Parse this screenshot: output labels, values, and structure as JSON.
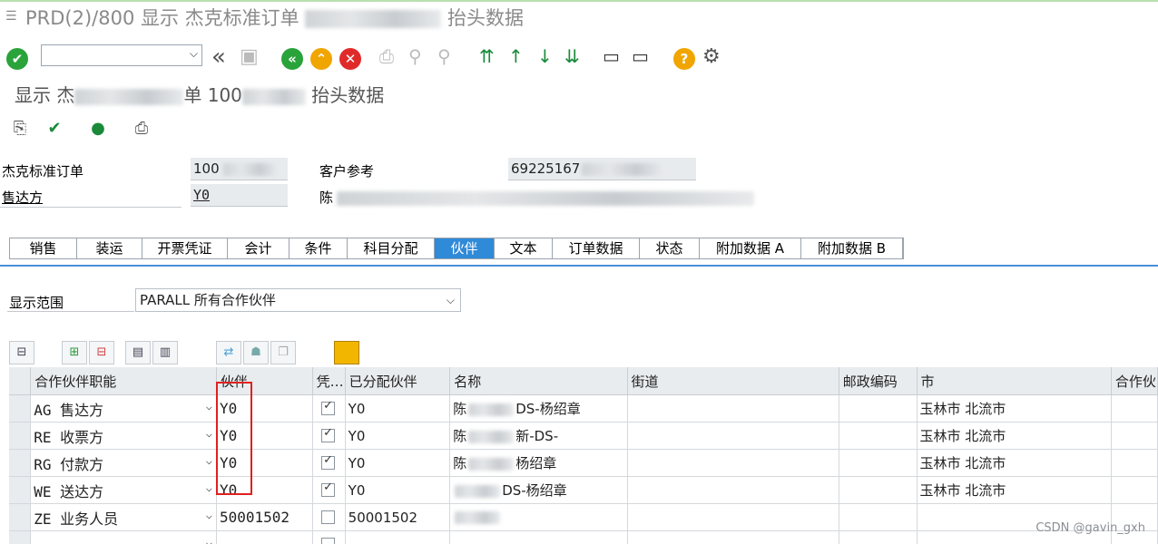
{
  "window": {
    "title_visible": "PRD(2)/800 显示 杰克标准订单 ",
    "title_end": "抬头数据"
  },
  "toolbar": {
    "command_field": "",
    "icons": [
      "enter-icon",
      "back-double-icon",
      "save-icon",
      "back-icon",
      "exit-icon",
      "cancel-icon",
      "print-icon",
      "find-icon",
      "find-next-icon",
      "first-page-icon",
      "prev-page-icon",
      "next-page-icon",
      "last-page-icon",
      "create-session-icon",
      "shortcut-icon",
      "help-icon",
      "settings-icon"
    ]
  },
  "page_title": {
    "prefix": "显示 杰",
    "mid": "单 100",
    "suffix": "抬头数据"
  },
  "header": {
    "order_label": "杰克标准订单",
    "order_value": "100",
    "customer_ref_label": "客户参考",
    "customer_ref_value": "69225167",
    "sold_to_label": "售达方",
    "sold_to_value": "Y0",
    "sold_to_name": "陈"
  },
  "tabs": [
    {
      "label": "销售",
      "width": 74
    },
    {
      "label": "装运",
      "width": 72
    },
    {
      "label": "开票凭证",
      "width": 94
    },
    {
      "label": "会计",
      "width": 68
    },
    {
      "label": "条件",
      "width": 64
    },
    {
      "label": "科目分配",
      "width": 96
    },
    {
      "label": "伙伴",
      "width": 66,
      "active": true
    },
    {
      "label": "文本",
      "width": 64
    },
    {
      "label": "订单数据",
      "width": 96
    },
    {
      "label": "状态",
      "width": 66
    },
    {
      "label": "附加数据 A",
      "width": 112
    },
    {
      "label": "附加数据 B",
      "width": 112
    }
  ],
  "display_range": {
    "label": "显示范围",
    "value": "PARALL 所有合作伙伴"
  },
  "grid": {
    "columns": [
      "合作伙伴职能",
      "伙伴",
      "凭…",
      "已分配伙伴",
      "名称",
      "街道",
      "邮政编码",
      "市",
      "合作伙"
    ],
    "rows": [
      {
        "role": "AG 售达方",
        "partner": "Y0",
        "checked": true,
        "assigned": "Y0",
        "name": "陈",
        "name_tail": "DS-杨绍章",
        "street": "",
        "postal": "",
        "city": "玉林市 北流市"
      },
      {
        "role": "RE 收票方",
        "partner": "Y0",
        "checked": true,
        "assigned": "Y0",
        "name": "陈",
        "name_tail": "新-DS-",
        "street": "",
        "postal": "",
        "city": "玉林市 北流市"
      },
      {
        "role": "RG 付款方",
        "partner": "Y0",
        "checked": true,
        "assigned": "Y0",
        "name": "陈",
        "name_tail": "杨绍章",
        "street": "",
        "postal": "",
        "city": "玉林市 北流市"
      },
      {
        "role": "WE 送达方",
        "partner": "Y0",
        "checked": true,
        "assigned": "Y0",
        "name": "",
        "name_tail": "DS-杨绍章",
        "street": "",
        "postal": "",
        "city": "玉林市 北流市"
      },
      {
        "role": "ZE 业务人员",
        "partner": "50001502",
        "checked": false,
        "assigned": "50001502",
        "name": "",
        "name_tail": "",
        "street": "",
        "postal": "",
        "city": ""
      },
      {
        "role": "",
        "partner": "",
        "checked": false,
        "assigned": "",
        "name": "",
        "name_tail": "",
        "street": "",
        "postal": "",
        "city": ""
      }
    ]
  },
  "watermark": "CSDN @gavin_gxh"
}
